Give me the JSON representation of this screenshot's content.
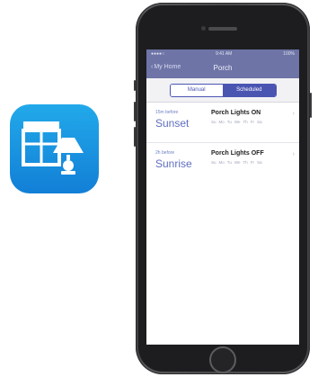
{
  "app_icon": {
    "icon": "window-blinds-lamp-icon",
    "colors": {
      "top": "#22a9ea",
      "bottom": "#127fd6"
    }
  },
  "status_bar": {
    "carrier": "●●●●○",
    "time": "9:41 AM",
    "battery": "100%"
  },
  "nav": {
    "back_label": "My Home",
    "title": "Porch"
  },
  "segment": {
    "manual": "Manual",
    "scheduled": "Scheduled",
    "selected": "Scheduled"
  },
  "schedules": [
    {
      "offset": "15m before",
      "event": "Sunset",
      "action": "Porch Lights ON",
      "days": [
        "Su",
        "Mo",
        "Tu",
        "We",
        "Th",
        "Fr",
        "Sa"
      ]
    },
    {
      "offset": "2h before",
      "event": "Sunrise",
      "action": "Porch Lights OFF",
      "days": [
        "Su",
        "Mo",
        "Tu",
        "We",
        "Th",
        "Fr",
        "Sa"
      ]
    }
  ],
  "colors": {
    "accent": "#4a55b2",
    "nav_bg": "#6e74a6",
    "phone_body": "#4a4a4c"
  }
}
